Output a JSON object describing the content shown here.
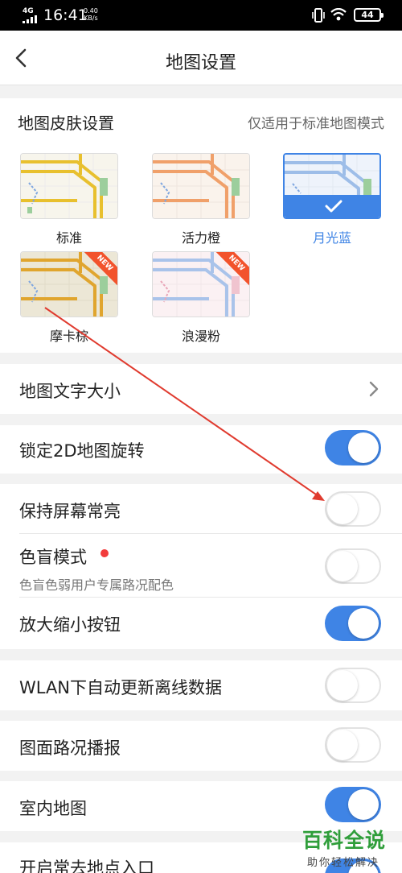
{
  "status_bar": {
    "network": "4G",
    "time": "16:41",
    "speed_value": "0.40",
    "speed_unit": "KB/s",
    "battery": "44"
  },
  "header": {
    "title": "地图设置"
  },
  "skin_section": {
    "title": "地图皮肤设置",
    "note": "仅适用于标准地图模式",
    "selected": "月光蓝",
    "badge": "NEW",
    "skins": [
      {
        "label": "标准",
        "road_color": "#e8c02e",
        "bg_color": "#f7f5ec"
      },
      {
        "label": "活力橙",
        "road_color": "#f0a06a",
        "bg_color": "#faf3ec"
      },
      {
        "label": "月光蓝",
        "road_color": "#9dbde8",
        "bg_color": "#eef3fb"
      },
      {
        "label": "摩卡棕",
        "road_color": "#e0a52e",
        "bg_color": "#ece7d6"
      },
      {
        "label": "浪漫粉",
        "road_color": "#a9c3ea",
        "bg_color": "#fbf1f3"
      }
    ]
  },
  "settings": {
    "text_size": {
      "label": "地图文字大小"
    },
    "lock_2d": {
      "label": "锁定2D地图旋转",
      "on": true
    },
    "keep_screen": {
      "label": "保持屏幕常亮",
      "on": false
    },
    "color_blind": {
      "label": "色盲模式",
      "sub": "色盲色弱用户专属路况配色",
      "on": false
    },
    "zoom_buttons": {
      "label": "放大缩小按钮",
      "on": true
    },
    "wlan_update": {
      "label": "WLAN下自动更新离线数据",
      "on": false
    },
    "traffic_broadcast": {
      "label": "图面路况播报",
      "on": false
    },
    "indoor_map": {
      "label": "室内地图",
      "on": true
    },
    "frequent_places": {
      "label": "开启常去地点入口"
    }
  },
  "watermark": {
    "title": "百科全说",
    "subtitle": "助你轻松解决"
  },
  "colors": {
    "accent": "#3f84e5",
    "red_dot": "#f23c3c",
    "arrow": "#e03b2f",
    "watermark": "#2f9e3a",
    "new_badge": "#f2532c"
  }
}
